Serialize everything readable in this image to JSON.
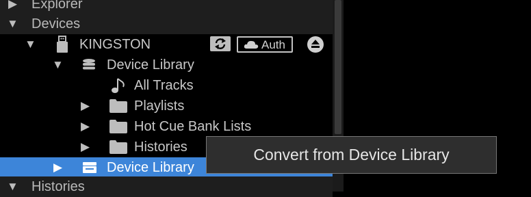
{
  "tree": {
    "explorer": {
      "label": "Explorer"
    },
    "devices": {
      "label": "Devices"
    },
    "kingston": {
      "label": "KINGSTON",
      "auth_label": "Auth"
    },
    "device_library": {
      "label": "Device Library"
    },
    "all_tracks": {
      "label": "All Tracks"
    },
    "playlists": {
      "label": "Playlists"
    },
    "hot_cue_bank_lists": {
      "label": "Hot Cue Bank Lists"
    },
    "histories_sub": {
      "label": "Histories"
    },
    "device_library_selected": {
      "label": "Device Library"
    },
    "histories": {
      "label": "Histories"
    }
  },
  "context_menu": {
    "items": [
      "Convert from Device Library"
    ]
  },
  "colors": {
    "selection": "#3d85d9",
    "section_row": "#1e1e1e",
    "background": "#000000"
  },
  "icons": [
    "chevron-right-icon",
    "chevron-down-icon",
    "usb-drive-icon",
    "sync-icon",
    "cloud-icon",
    "eject-icon",
    "database-icon",
    "music-note-icon",
    "folder-icon",
    "library-icon"
  ]
}
